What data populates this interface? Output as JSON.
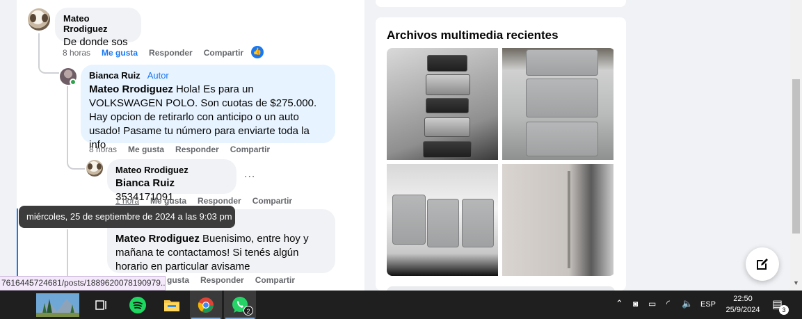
{
  "comments": {
    "c1": {
      "author": "Mateo Rrodiguez",
      "text": "De donde sos",
      "time": "8 horas",
      "like": "Me gusta",
      "reply": "Responder",
      "share": "Compartir"
    },
    "c2": {
      "author": "Bianca Ruiz",
      "tag": "Autor",
      "mention": "Mateo Rrodiguez",
      "text": " Hola! Es para un VOLKSWAGEN POLO. Son cuotas de $275.000. Hay opcion de retirarlo con anticipo o un auto usado! Pasame tu número para enviarte toda la info",
      "time": "8 horas",
      "like": "Me gusta",
      "reply": "Responder",
      "share": "Compartir"
    },
    "c3": {
      "author": "Mateo Rrodiguez",
      "mention": "Bianca Ruiz",
      "text": " 3534171091",
      "time": "1 hora",
      "like": "Me gusta",
      "reply": "Responder",
      "share": "Compartir",
      "more": "..."
    },
    "c4": {
      "mention": "Mateo Rrodiguez",
      "text": " Buenisimo, entre hoy y mañana te contactamos! Si tenés algún horario en particular avisame",
      "like": "gusta",
      "reply": "Responder",
      "share": "Compartir"
    }
  },
  "tooltip": "miércoles, 25 de septiembre de 2024 a las 9:03 pm",
  "status_url": "7616445724681/posts/1889620078190979...",
  "media": {
    "title": "Archivos multimedia recientes"
  },
  "taskbar": {
    "whatsapp_badge": "2",
    "language": "ESP",
    "time": "22:50",
    "date": "25/9/2024",
    "notifications": "3"
  }
}
